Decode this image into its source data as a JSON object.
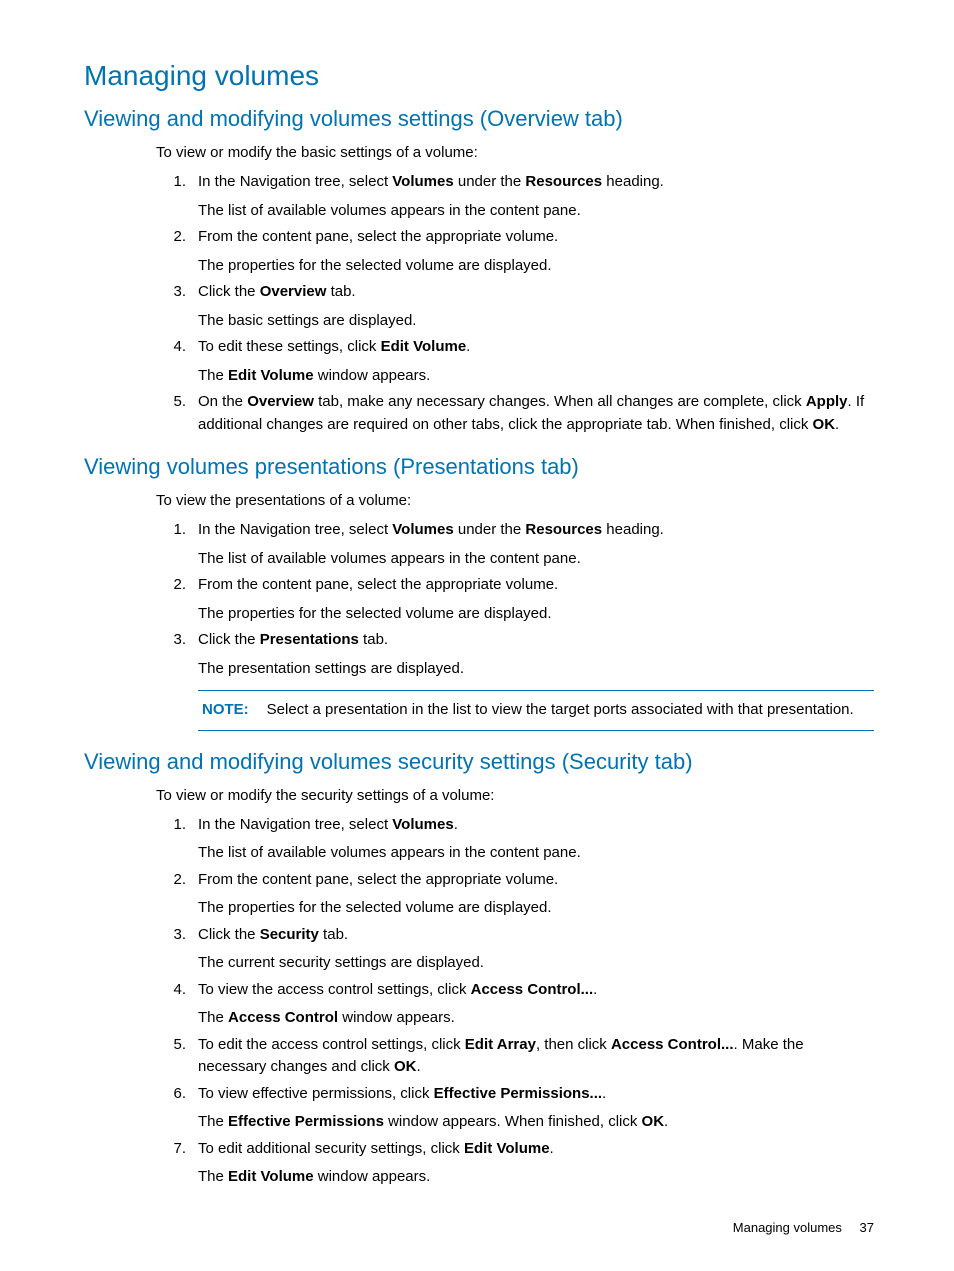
{
  "h1": "Managing volumes",
  "section1": {
    "title": "Viewing and modifying volumes settings (Overview tab)",
    "intro": "To view or modify the basic settings of a volume:",
    "steps": [
      {
        "num": "1.",
        "parts": [
          "In the Navigation tree, select ",
          {
            "b": "Volumes"
          },
          " under the ",
          {
            "b": "Resources"
          },
          " heading."
        ],
        "sub": "The list of available volumes appears in the content pane."
      },
      {
        "num": "2.",
        "parts": [
          "From the content pane, select the appropriate volume."
        ],
        "sub": "The properties for the selected volume are displayed."
      },
      {
        "num": "3.",
        "parts": [
          "Click the ",
          {
            "b": "Overview"
          },
          " tab."
        ],
        "sub": "The basic settings are displayed."
      },
      {
        "num": "4.",
        "parts": [
          "To edit these settings, click ",
          {
            "b": "Edit Volume"
          },
          "."
        ],
        "subParts": [
          "The ",
          {
            "b": "Edit Volume"
          },
          " window appears."
        ]
      },
      {
        "num": "5.",
        "parts": [
          "On the ",
          {
            "b": "Overview"
          },
          " tab, make any necessary changes. When all changes are complete, click ",
          {
            "b": "Apply"
          },
          ". If additional changes are required on other tabs, click the appropriate tab. When finished, click ",
          {
            "b": "OK"
          },
          "."
        ]
      }
    ]
  },
  "section2": {
    "title": "Viewing volumes presentations (Presentations tab)",
    "intro": "To view the presentations of a volume:",
    "steps": [
      {
        "num": "1.",
        "parts": [
          "In the Navigation tree, select ",
          {
            "b": "Volumes"
          },
          " under the ",
          {
            "b": "Resources"
          },
          " heading."
        ],
        "sub": "The list of available volumes appears in the content pane."
      },
      {
        "num": "2.",
        "parts": [
          "From the content pane, select the appropriate volume."
        ],
        "sub": "The properties for the selected volume are displayed."
      },
      {
        "num": "3.",
        "parts": [
          "Click the ",
          {
            "b": "Presentations"
          },
          " tab."
        ],
        "sub": "The presentation settings are displayed."
      }
    ],
    "note": {
      "label": "NOTE:",
      "text": "Select a presentation in the list to view the target ports associated with that presentation."
    }
  },
  "section3": {
    "title": "Viewing and modifying volumes security settings (Security tab)",
    "intro": "To view or modify the security settings of a volume:",
    "steps": [
      {
        "num": "1.",
        "parts": [
          "In the Navigation tree, select ",
          {
            "b": "Volumes"
          },
          "."
        ],
        "sub": "The list of available volumes appears in the content pane."
      },
      {
        "num": "2.",
        "parts": [
          "From the content pane, select the appropriate volume."
        ],
        "sub": "The properties for the selected volume are displayed."
      },
      {
        "num": "3.",
        "parts": [
          "Click the ",
          {
            "b": "Security"
          },
          " tab."
        ],
        "sub": "The current security settings are displayed."
      },
      {
        "num": "4.",
        "parts": [
          "To view the access control settings, click ",
          {
            "b": "Access Control..."
          },
          "."
        ],
        "subParts": [
          "The ",
          {
            "b": "Access Control"
          },
          " window appears."
        ]
      },
      {
        "num": "5.",
        "parts": [
          "To edit the access control settings, click ",
          {
            "b": "Edit Array"
          },
          ", then click ",
          {
            "b": "Access Control..."
          },
          ". Make the necessary changes and click ",
          {
            "b": "OK"
          },
          "."
        ]
      },
      {
        "num": "6.",
        "parts": [
          "To view effective permissions, click ",
          {
            "b": "Effective Permissions..."
          },
          "."
        ],
        "subParts": [
          "The ",
          {
            "b": "Effective Permissions"
          },
          " window appears. When finished, click ",
          {
            "b": "OK"
          },
          "."
        ]
      },
      {
        "num": "7.",
        "parts": [
          "To edit additional security settings, click ",
          {
            "b": "Edit Volume"
          },
          "."
        ],
        "subParts": [
          "The ",
          {
            "b": "Edit Volume"
          },
          " window appears."
        ]
      }
    ]
  },
  "footer": {
    "text": "Managing volumes",
    "page": "37"
  }
}
